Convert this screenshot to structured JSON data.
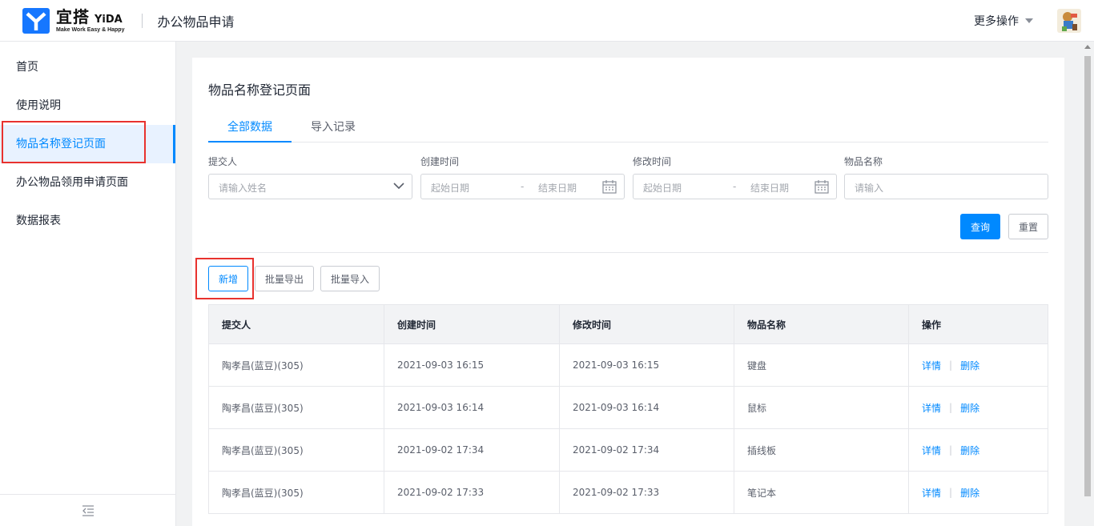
{
  "header": {
    "logo_cn": "宜搭",
    "logo_en": "YiDA",
    "logo_slogan": "Make Work Easy & Happy",
    "app_title": "办公物品申请",
    "more_ops": "更多操作"
  },
  "sidebar": {
    "items": [
      {
        "label": "首页"
      },
      {
        "label": "使用说明"
      },
      {
        "label": "物品名称登记页面"
      },
      {
        "label": "办公物品领用申请页面"
      },
      {
        "label": "数据报表"
      }
    ],
    "active_index": 2
  },
  "page": {
    "title": "物品名称登记页面",
    "tabs": [
      {
        "label": "全部数据"
      },
      {
        "label": "导入记录"
      }
    ]
  },
  "filters": {
    "submitter_label": "提交人",
    "submitter_placeholder": "请输入姓名",
    "created_label": "创建时间",
    "modified_label": "修改时间",
    "start_placeholder": "起始日期",
    "end_placeholder": "结束日期",
    "range_sep": "-",
    "item_label": "物品名称",
    "item_placeholder": "请输入",
    "search_label": "查询",
    "reset_label": "重置"
  },
  "toolbar": {
    "add_label": "新增",
    "export_label": "批量导出",
    "import_label": "批量导入"
  },
  "table": {
    "columns": [
      "提交人",
      "创建时间",
      "修改时间",
      "物品名称",
      "操作"
    ],
    "rows": [
      {
        "submitter": "陶孝昌(蓝豆)(305)",
        "created": "2021-09-03 16:15",
        "modified": "2021-09-03 16:15",
        "item": "键盘"
      },
      {
        "submitter": "陶孝昌(蓝豆)(305)",
        "created": "2021-09-03 16:14",
        "modified": "2021-09-03 16:14",
        "item": "鼠标"
      },
      {
        "submitter": "陶孝昌(蓝豆)(305)",
        "created": "2021-09-02 17:34",
        "modified": "2021-09-02 17:34",
        "item": "插线板"
      },
      {
        "submitter": "陶孝昌(蓝豆)(305)",
        "created": "2021-09-02 17:33",
        "modified": "2021-09-02 17:33",
        "item": "笔记本"
      }
    ],
    "detail_label": "详情",
    "delete_label": "删除",
    "op_sep": "|"
  },
  "colors": {
    "primary": "#0089ff",
    "highlight_box": "#e8322e",
    "logo_blue": "#1677ff"
  }
}
